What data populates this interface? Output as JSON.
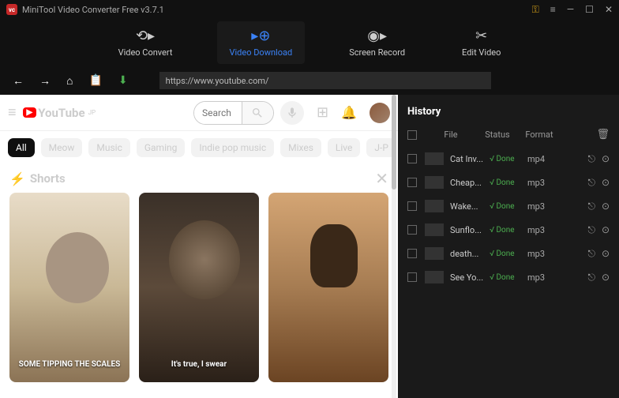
{
  "titlebar": {
    "title": "MiniTool Video Converter Free v3.7.1"
  },
  "tabs": [
    {
      "label": "Video Convert"
    },
    {
      "label": "Video Download"
    },
    {
      "label": "Screen Record"
    },
    {
      "label": "Edit Video"
    }
  ],
  "url": "https://www.youtube.com/",
  "youtube": {
    "brand": "YouTube",
    "region": "JP",
    "search_placeholder": "Search",
    "chips": [
      "All",
      "Meow",
      "Music",
      "Gaming",
      "Indie pop music",
      "Mixes",
      "Live",
      "J-P"
    ],
    "shorts_title": "Shorts",
    "shorts": [
      {
        "caption": "SOME TIPPING THE SCALES"
      },
      {
        "caption": "It's true, I swear"
      },
      {
        "caption": ""
      }
    ]
  },
  "history": {
    "title": "History",
    "cols": {
      "file": "File",
      "status": "Status",
      "format": "Format"
    },
    "rows": [
      {
        "file": "Cat Inv...",
        "status": "√ Done",
        "format": "mp4"
      },
      {
        "file": "Cheap...",
        "status": "√ Done",
        "format": "mp3"
      },
      {
        "file": "Wake...",
        "status": "√ Done",
        "format": "mp3"
      },
      {
        "file": "Sunflo...",
        "status": "√ Done",
        "format": "mp3"
      },
      {
        "file": "death...",
        "status": "√ Done",
        "format": "mp3"
      },
      {
        "file": "See Yo...",
        "status": "√ Done",
        "format": "mp3"
      }
    ]
  }
}
